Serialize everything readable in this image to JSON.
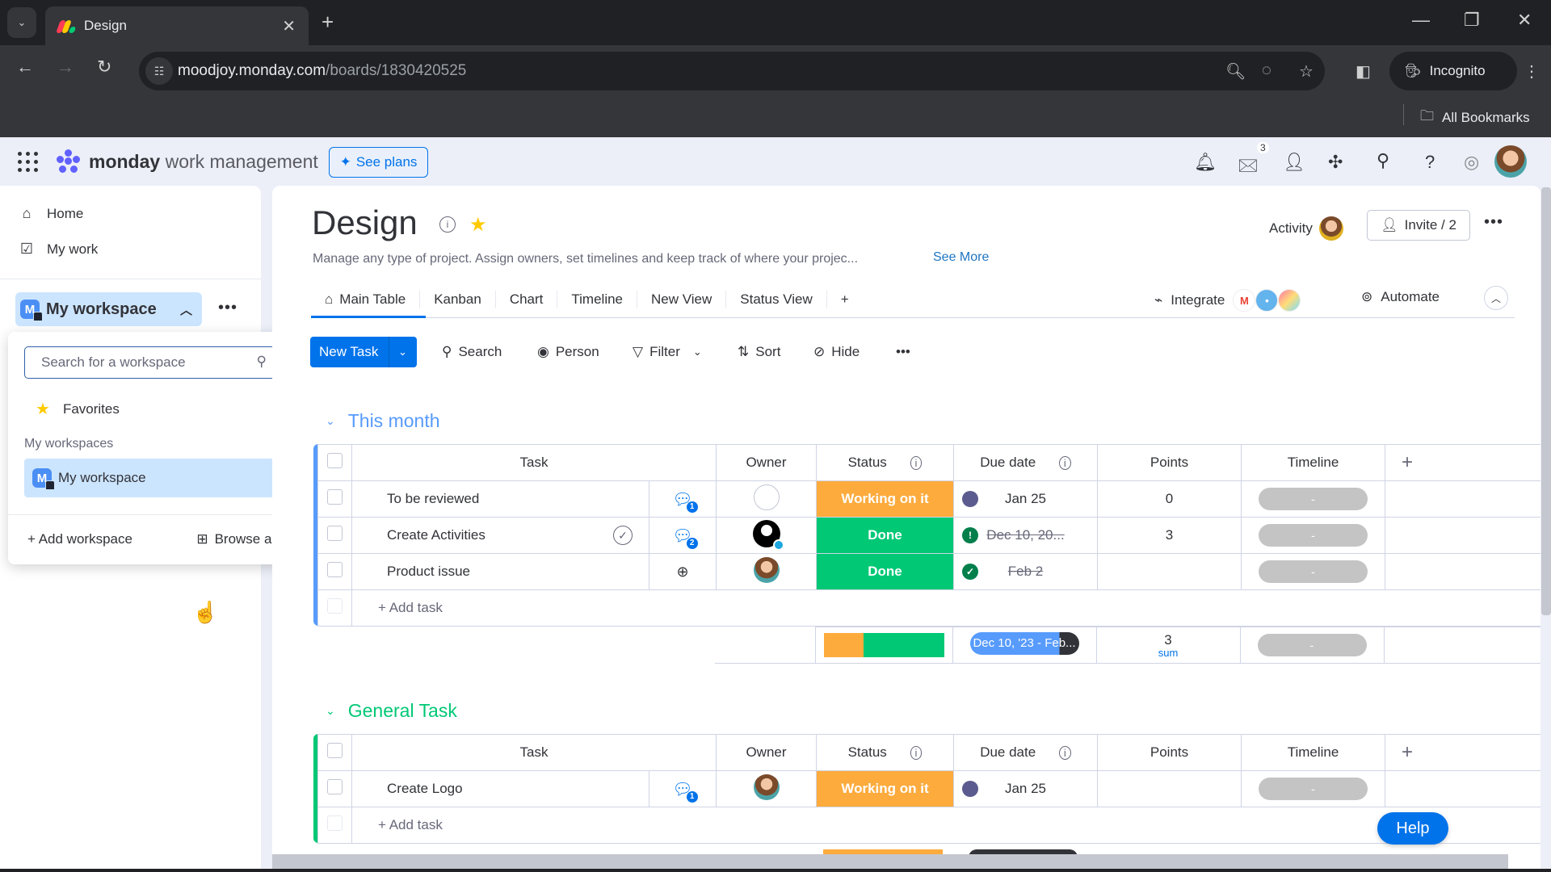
{
  "browser": {
    "tab_title": "Design",
    "url_host": "moodjoy.monday.com",
    "url_path": "/boards/1830420525",
    "incognito_label": "Incognito",
    "all_bookmarks_label": "All Bookmarks"
  },
  "topbar": {
    "brand_bold": "monday",
    "brand_rest": "work management",
    "see_plans_label": "See plans",
    "inbox_count": "3"
  },
  "sidebar": {
    "home_label": "Home",
    "my_work_label": "My work",
    "workspace_name": "My workspace",
    "workspace_initial": "M"
  },
  "workspace_dropdown": {
    "search_placeholder": "Search for a workspace",
    "favorites_label": "Favorites",
    "section_label": "My workspaces",
    "workspace_option": "My workspace",
    "add_workspace_label": "+ Add workspace",
    "browse_all_label": "Browse all"
  },
  "board": {
    "title": "Design",
    "description": "Manage any type of project. Assign owners, set timelines and keep track of where your projec...",
    "see_more_label": "See More",
    "activity_label": "Activity",
    "invite_label": "Invite / 2",
    "views": [
      "Main Table",
      "Kanban",
      "Chart",
      "Timeline",
      "New View",
      "Status View"
    ],
    "integrate_label": "Integrate",
    "automate_label": "Automate"
  },
  "filterbar": {
    "new_task_label": "New Task",
    "search_label": "Search",
    "person_label": "Person",
    "filter_label": "Filter",
    "sort_label": "Sort",
    "hide_label": "Hide"
  },
  "columns": {
    "task": "Task",
    "owner": "Owner",
    "status": "Status",
    "due_date": "Due date",
    "points": "Points",
    "timeline": "Timeline"
  },
  "colors": {
    "working_on_it": "#fdab3d",
    "done": "#00c875",
    "group_this_month": "#579bfc",
    "group_general": "#00c875",
    "primary": "#0073ea"
  },
  "groups": [
    {
      "title": "This month",
      "rows": [
        {
          "task": "To be reviewed",
          "updates": "1",
          "owner": "empty",
          "status": "Working on it",
          "due": "Jan 25",
          "due_state": "pending",
          "points": "0",
          "timeline": "-"
        },
        {
          "task": "Create Activities",
          "updates": "2",
          "owner": "black",
          "status": "Done",
          "due": "Dec 10, 20...",
          "due_state": "overdue-done",
          "points": "3",
          "timeline": "-"
        },
        {
          "task": "Product issue",
          "updates": "",
          "owner": "photo",
          "status": "Done",
          "due": "Feb 2",
          "due_state": "done",
          "points": "",
          "timeline": "-"
        }
      ],
      "add_task_label": "+ Add task",
      "summary": {
        "status_distribution": {
          "working_on_it": 0.33,
          "done": 0.67
        },
        "due_range": "Dec 10, '23 - Feb...",
        "points_sum": "3",
        "points_sum_label": "sum",
        "timeline": "-"
      }
    },
    {
      "title": "General Task",
      "rows": [
        {
          "task": "Create Logo",
          "updates": "1",
          "owner": "photo",
          "status": "Working on it",
          "due": "Jan 25",
          "due_state": "pending",
          "points": "",
          "timeline": "-"
        }
      ],
      "add_task_label": "+ Add task"
    }
  ],
  "help_label": "Help"
}
